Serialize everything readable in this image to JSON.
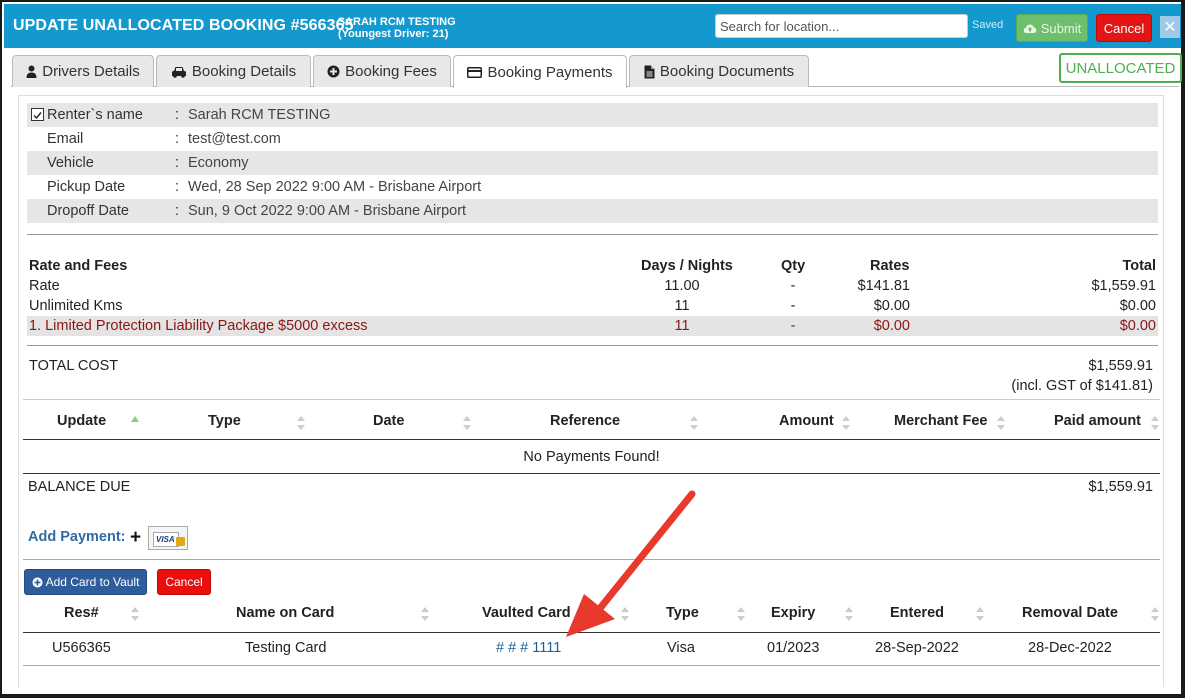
{
  "header": {
    "title": "UPDATE UNALLOCATED BOOKING #566365",
    "subtitle_line1": "- SARAH RCM TESTING",
    "subtitle_line2": "(Youngest Driver: 21)",
    "search_placeholder": "Search for location...",
    "saved_label": "Saved",
    "submit_label": "Submit",
    "cancel_label": "Cancel",
    "close_label": "✕",
    "accent": "#1499cf"
  },
  "tabs": [
    {
      "label": "Drivers Details",
      "icon": "user-icon"
    },
    {
      "label": "Booking Details",
      "icon": "car-icon"
    },
    {
      "label": "Booking Fees",
      "icon": "plus-circle-icon"
    },
    {
      "label": "Booking Payments",
      "icon": "credit-card-icon",
      "active": true
    },
    {
      "label": "Booking Documents",
      "icon": "document-icon"
    }
  ],
  "status_badge": "UNALLOCATED",
  "renter": {
    "rows": [
      {
        "label": "Renter`s name",
        "value": "Sarah RCM TESTING"
      },
      {
        "label": "Email",
        "value": "test@test.com"
      },
      {
        "label": "Vehicle",
        "value": "Economy"
      },
      {
        "label": "Pickup Date",
        "value": "Wed, 28 Sep 2022 9:00 AM - Brisbane Airport"
      },
      {
        "label": "Dropoff Date",
        "value": "Sun, 9 Oct 2022 9:00 AM - Brisbane Airport"
      }
    ]
  },
  "fees": {
    "headers": {
      "name": "Rate and Fees",
      "days": "Days / Nights",
      "qty": "Qty",
      "rates": "Rates",
      "total": "Total"
    },
    "rows": [
      {
        "name": "Rate",
        "days": "11.00",
        "qty": "-",
        "rates": "$141.81",
        "total": "$1,559.91"
      },
      {
        "name": "Unlimited Kms",
        "days": "11",
        "qty": "-",
        "rates": "$0.00",
        "total": "$0.00"
      },
      {
        "name": "1. Limited Protection Liability Package $5000 excess",
        "days": "11",
        "qty": "-",
        "rates": "$0.00",
        "total": "$0.00"
      }
    ],
    "total_label": "TOTAL COST",
    "total_value": "$1,559.91",
    "gst_note": "(incl. GST of $141.81)"
  },
  "payments": {
    "headers": [
      "Update",
      "Type",
      "Date",
      "Reference",
      "Amount",
      "Merchant Fee",
      "Paid amount"
    ],
    "empty_message": "No Payments Found!",
    "balance_label": "BALANCE DUE",
    "balance_value": "$1,559.91",
    "add_payment_label": "Add Payment:",
    "add_icon": "+",
    "visa_label": "VISA"
  },
  "vault": {
    "add_card_label": "Add Card to Vault",
    "cancel_label": "Cancel",
    "headers": [
      "Res#",
      "Name on Card",
      "Vaulted Card",
      "Type",
      "Expiry",
      "Entered",
      "Removal Date"
    ],
    "rows": [
      {
        "res": "U566365",
        "name": "Testing Card",
        "card": "# # # 1111",
        "type": "Visa",
        "expiry": "01/2023",
        "entered": "28-Sep-2022",
        "removal": "28-Dec-2022"
      }
    ]
  }
}
